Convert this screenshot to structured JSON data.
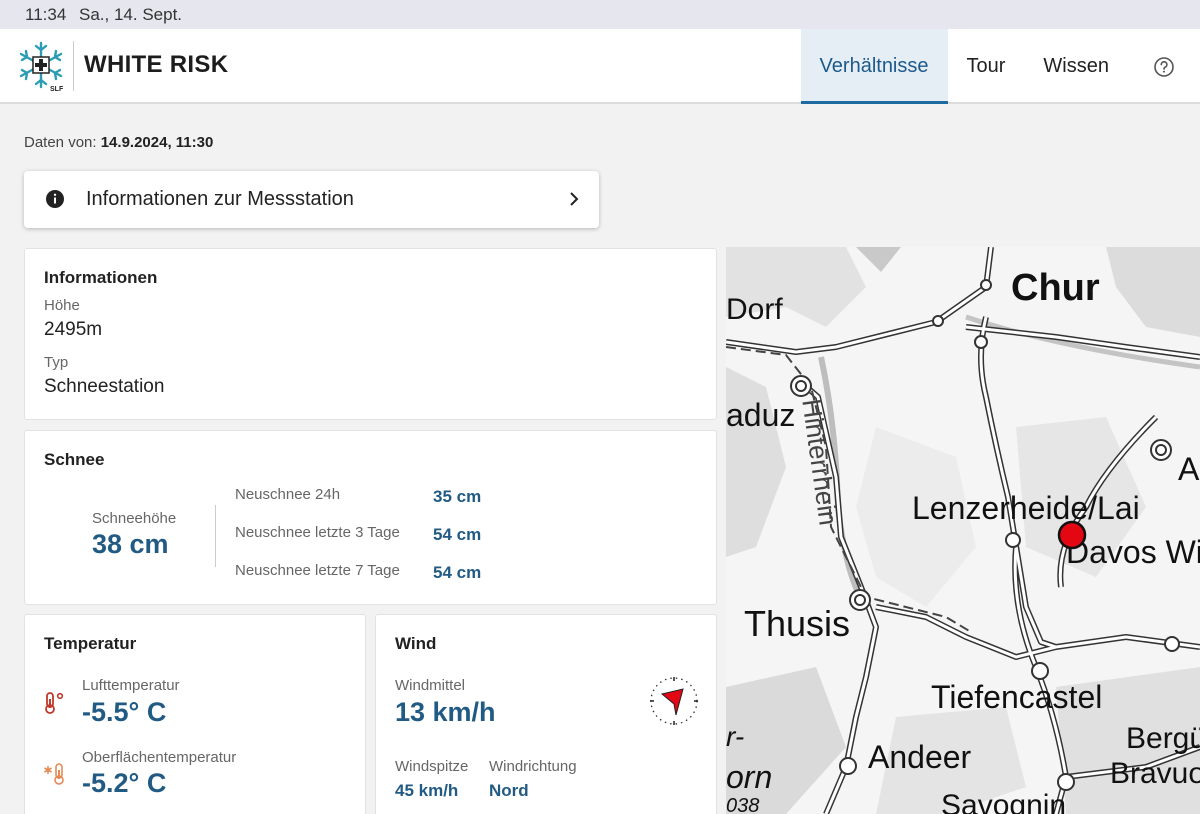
{
  "statusbar": {
    "time": "11:34",
    "date": "Sa., 14. Sept."
  },
  "header": {
    "brand": "WHITE RISK",
    "logo_text": "SLF",
    "tabs": [
      {
        "label": "Verhältnisse",
        "active": true
      },
      {
        "label": "Tour",
        "active": false
      },
      {
        "label": "Wissen",
        "active": false
      }
    ],
    "help_icon": "question-circle-icon"
  },
  "data_from": {
    "label": "Daten von:",
    "value": "14.9.2024, 11:30"
  },
  "station_info_link": {
    "label": "Informationen zur Messstation",
    "icon": "info-circle-icon"
  },
  "informationen": {
    "title": "Informationen",
    "hoehe_label": "Höhe",
    "hoehe_value": "2495m",
    "typ_label": "Typ",
    "typ_value": "Schneestation"
  },
  "schnee": {
    "title": "Schnee",
    "schneehoehe_label": "Schneehöhe",
    "schneehoehe_value": "38 cm",
    "rows": [
      {
        "label": "Neuschnee 24h",
        "value": "35 cm"
      },
      {
        "label": "Neuschnee letzte 3 Tage",
        "value": "54 cm"
      },
      {
        "label": "Neuschnee letzte 7 Tage",
        "value": "54 cm"
      }
    ]
  },
  "temperatur": {
    "title": "Temperatur",
    "luft_label": "Lufttemperatur",
    "luft_value": "-5.5° C",
    "oberflaeche_label": "Oberflächentemperatur",
    "oberflaeche_value": "-5.2° C",
    "accent": "#c0392b"
  },
  "wind": {
    "title": "Wind",
    "mittel_label": "Windmittel",
    "mittel_value": "13 km/h",
    "spitze_label": "Windspitze",
    "spitze_value": "45 km/h",
    "richtung_label": "Windrichtung",
    "richtung_value": "Nord",
    "compass_icon": "wind-direction-compass-icon"
  },
  "map": {
    "labels": [
      "Chur",
      "Dorf",
      "aduz",
      "Hinterrhein",
      "Lenzerheide/Lai",
      "Davos Wie",
      "Thusis",
      "Tiefencastel",
      "Andeer",
      "Bergü",
      "Bravuo",
      "Savognin",
      "A",
      "orn",
      "r-",
      "038"
    ],
    "station_marker_color": "#e30613"
  },
  "colors": {
    "accent_blue": "#215b84",
    "nav_active_bg": "#e6eef5"
  }
}
